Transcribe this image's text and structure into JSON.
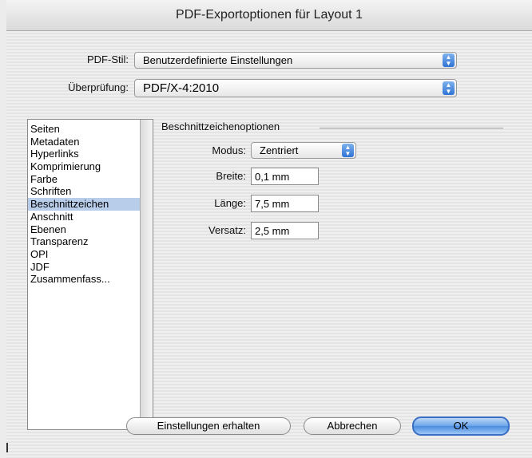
{
  "window": {
    "title": "PDF-Exportoptionen für Layout 1"
  },
  "pdf_stil": {
    "label": "PDF-Stil:",
    "value": "Benutzerdefinierte Einstellungen"
  },
  "ueberpruefung": {
    "label": "Überprüfung:",
    "value": "PDF/X-4:2010"
  },
  "sidebar": {
    "items": [
      "Seiten",
      "Metadaten",
      "Hyperlinks",
      "Komprimierung",
      "Farbe",
      "Schriften",
      "Beschnittzeichen",
      "Anschnitt",
      "Ebenen",
      "Transparenz",
      "OPI",
      "JDF",
      "Zusammenfass..."
    ],
    "selected": "Beschnittzeichen"
  },
  "section": {
    "title": "Beschnittzeichenoptionen"
  },
  "modus": {
    "label": "Modus:",
    "value": "Zentriert"
  },
  "breite": {
    "label": "Breite:",
    "value": "0,1 mm"
  },
  "laenge": {
    "label": "Länge:",
    "value": "7,5 mm"
  },
  "versatz": {
    "label": "Versatz:",
    "value": "2,5 mm"
  },
  "buttons": {
    "keep": "Einstellungen erhalten",
    "cancel": "Abbrechen",
    "ok": "OK"
  },
  "colors": {
    "accent": "#4a8ce0",
    "selection": "#b7cdea"
  }
}
